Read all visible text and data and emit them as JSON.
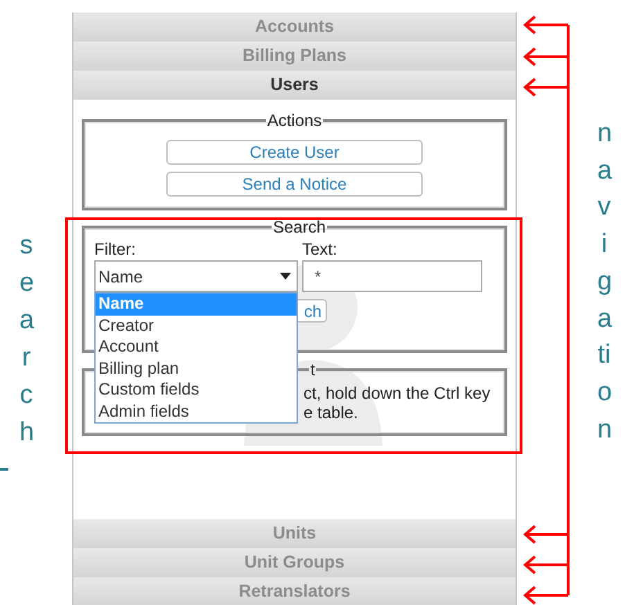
{
  "navigation_top": [
    {
      "label": "Accounts",
      "selected": false
    },
    {
      "label": "Billing Plans",
      "selected": false
    },
    {
      "label": "Users",
      "selected": true
    }
  ],
  "actions": {
    "legend": "Actions",
    "buttons": [
      "Create User",
      "Send a Notice"
    ]
  },
  "search": {
    "legend": "Search",
    "filter_label": "Filter:",
    "filter_value": "Name",
    "text_label": "Text:",
    "text_value": "*",
    "options": [
      {
        "label": "Name",
        "selected": true
      },
      {
        "label": "Creator",
        "selected": false
      },
      {
        "label": "Account",
        "selected": false
      },
      {
        "label": "Billing plan",
        "selected": false
      },
      {
        "label": "Custom fields",
        "selected": false
      },
      {
        "label": "Admin fields",
        "selected": false
      }
    ],
    "button": "ch"
  },
  "hint_section": {
    "legend": "t",
    "lines": [
      "ct, hold down the Ctrl key",
      "e table."
    ]
  },
  "navigation_bottom": [
    {
      "label": "Units",
      "selected": false
    },
    {
      "label": "Unit Groups",
      "selected": false
    },
    {
      "label": "Retranslators",
      "selected": false
    }
  ],
  "annotations": {
    "left_label": "search",
    "right_label": "navigation"
  }
}
